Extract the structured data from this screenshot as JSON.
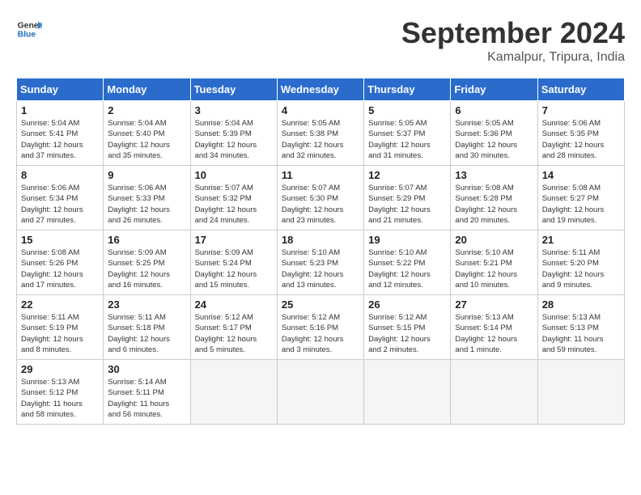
{
  "header": {
    "logo_line1": "General",
    "logo_line2": "Blue",
    "month_title": "September 2024",
    "location": "Kamalpur, Tripura, India"
  },
  "weekdays": [
    "Sunday",
    "Monday",
    "Tuesday",
    "Wednesday",
    "Thursday",
    "Friday",
    "Saturday"
  ],
  "weeks": [
    [
      {
        "day": "1",
        "info": "Sunrise: 5:04 AM\nSunset: 5:41 PM\nDaylight: 12 hours\nand 37 minutes."
      },
      {
        "day": "2",
        "info": "Sunrise: 5:04 AM\nSunset: 5:40 PM\nDaylight: 12 hours\nand 35 minutes."
      },
      {
        "day": "3",
        "info": "Sunrise: 5:04 AM\nSunset: 5:39 PM\nDaylight: 12 hours\nand 34 minutes."
      },
      {
        "day": "4",
        "info": "Sunrise: 5:05 AM\nSunset: 5:38 PM\nDaylight: 12 hours\nand 32 minutes."
      },
      {
        "day": "5",
        "info": "Sunrise: 5:05 AM\nSunset: 5:37 PM\nDaylight: 12 hours\nand 31 minutes."
      },
      {
        "day": "6",
        "info": "Sunrise: 5:05 AM\nSunset: 5:36 PM\nDaylight: 12 hours\nand 30 minutes."
      },
      {
        "day": "7",
        "info": "Sunrise: 5:06 AM\nSunset: 5:35 PM\nDaylight: 12 hours\nand 28 minutes."
      }
    ],
    [
      {
        "day": "8",
        "info": "Sunrise: 5:06 AM\nSunset: 5:34 PM\nDaylight: 12 hours\nand 27 minutes."
      },
      {
        "day": "9",
        "info": "Sunrise: 5:06 AM\nSunset: 5:33 PM\nDaylight: 12 hours\nand 26 minutes."
      },
      {
        "day": "10",
        "info": "Sunrise: 5:07 AM\nSunset: 5:32 PM\nDaylight: 12 hours\nand 24 minutes."
      },
      {
        "day": "11",
        "info": "Sunrise: 5:07 AM\nSunset: 5:30 PM\nDaylight: 12 hours\nand 23 minutes."
      },
      {
        "day": "12",
        "info": "Sunrise: 5:07 AM\nSunset: 5:29 PM\nDaylight: 12 hours\nand 21 minutes."
      },
      {
        "day": "13",
        "info": "Sunrise: 5:08 AM\nSunset: 5:28 PM\nDaylight: 12 hours\nand 20 minutes."
      },
      {
        "day": "14",
        "info": "Sunrise: 5:08 AM\nSunset: 5:27 PM\nDaylight: 12 hours\nand 19 minutes."
      }
    ],
    [
      {
        "day": "15",
        "info": "Sunrise: 5:08 AM\nSunset: 5:26 PM\nDaylight: 12 hours\nand 17 minutes."
      },
      {
        "day": "16",
        "info": "Sunrise: 5:09 AM\nSunset: 5:25 PM\nDaylight: 12 hours\nand 16 minutes."
      },
      {
        "day": "17",
        "info": "Sunrise: 5:09 AM\nSunset: 5:24 PM\nDaylight: 12 hours\nand 15 minutes."
      },
      {
        "day": "18",
        "info": "Sunrise: 5:10 AM\nSunset: 5:23 PM\nDaylight: 12 hours\nand 13 minutes."
      },
      {
        "day": "19",
        "info": "Sunrise: 5:10 AM\nSunset: 5:22 PM\nDaylight: 12 hours\nand 12 minutes."
      },
      {
        "day": "20",
        "info": "Sunrise: 5:10 AM\nSunset: 5:21 PM\nDaylight: 12 hours\nand 10 minutes."
      },
      {
        "day": "21",
        "info": "Sunrise: 5:11 AM\nSunset: 5:20 PM\nDaylight: 12 hours\nand 9 minutes."
      }
    ],
    [
      {
        "day": "22",
        "info": "Sunrise: 5:11 AM\nSunset: 5:19 PM\nDaylight: 12 hours\nand 8 minutes."
      },
      {
        "day": "23",
        "info": "Sunrise: 5:11 AM\nSunset: 5:18 PM\nDaylight: 12 hours\nand 6 minutes."
      },
      {
        "day": "24",
        "info": "Sunrise: 5:12 AM\nSunset: 5:17 PM\nDaylight: 12 hours\nand 5 minutes."
      },
      {
        "day": "25",
        "info": "Sunrise: 5:12 AM\nSunset: 5:16 PM\nDaylight: 12 hours\nand 3 minutes."
      },
      {
        "day": "26",
        "info": "Sunrise: 5:12 AM\nSunset: 5:15 PM\nDaylight: 12 hours\nand 2 minutes."
      },
      {
        "day": "27",
        "info": "Sunrise: 5:13 AM\nSunset: 5:14 PM\nDaylight: 12 hours\nand 1 minute."
      },
      {
        "day": "28",
        "info": "Sunrise: 5:13 AM\nSunset: 5:13 PM\nDaylight: 11 hours\nand 59 minutes."
      }
    ],
    [
      {
        "day": "29",
        "info": "Sunrise: 5:13 AM\nSunset: 5:12 PM\nDaylight: 11 hours\nand 58 minutes."
      },
      {
        "day": "30",
        "info": "Sunrise: 5:14 AM\nSunset: 5:11 PM\nDaylight: 11 hours\nand 56 minutes."
      },
      {
        "day": "",
        "info": ""
      },
      {
        "day": "",
        "info": ""
      },
      {
        "day": "",
        "info": ""
      },
      {
        "day": "",
        "info": ""
      },
      {
        "day": "",
        "info": ""
      }
    ]
  ]
}
